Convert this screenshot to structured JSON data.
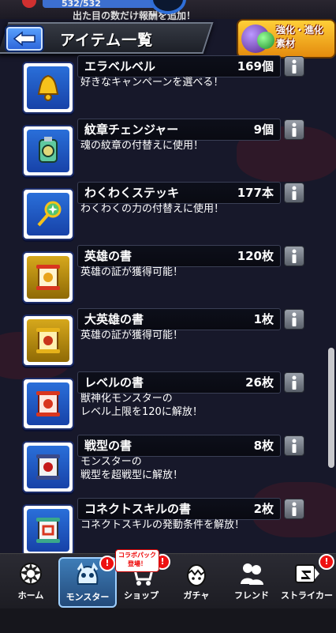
{
  "status": {
    "hp_text": "532/532",
    "top_note": "出た目の数だけ報酬を追加！"
  },
  "header": {
    "title": "アイテム一覧",
    "evolution_badge": "強化・進化素材"
  },
  "items": [
    {
      "name": "エラベルベル",
      "qty": "169個",
      "desc": "好きなキャンペーンを選べる！",
      "icon": "bell-icon"
    },
    {
      "name": "紋章チェンジャー",
      "qty": "9個",
      "desc": "魂の紋章の付替えに使用！",
      "icon": "emblem-changer-icon"
    },
    {
      "name": "わくわくステッキ",
      "qty": "177本",
      "desc": "わくわくの力の付替えに使用！",
      "icon": "wand-icon"
    },
    {
      "name": "英雄の書",
      "qty": "120枚",
      "desc": "英雄の証が獲得可能！",
      "icon": "scroll-icon"
    },
    {
      "name": "大英雄の書",
      "qty": "1枚",
      "desc": "英雄の証が獲得可能！",
      "icon": "scroll-icon"
    },
    {
      "name": "レベルの書",
      "qty": "26枚",
      "desc": "獣神化モンスターの\nレベル上限を120に解放！",
      "icon": "scroll-icon"
    },
    {
      "name": "戦型の書",
      "qty": "8枚",
      "desc": "モンスターの\n戦型を超戦型に解放！",
      "icon": "scroll-icon"
    },
    {
      "name": "コネクトスキルの書",
      "qty": "2枚",
      "desc": "コネクトスキルの発動条件を解放！",
      "icon": "scroll-icon"
    }
  ],
  "nav": [
    {
      "label": "ホーム",
      "icon": "home-icon",
      "alert": false
    },
    {
      "label": "モンスター",
      "icon": "monster-icon",
      "alert": true
    },
    {
      "label": "ショップ",
      "icon": "shop-cart-icon",
      "alert": true,
      "promo": "コラボパック\n登場！"
    },
    {
      "label": "ガチャ",
      "icon": "gacha-egg-icon",
      "alert": false
    },
    {
      "label": "フレンド",
      "icon": "friends-icon",
      "alert": false
    },
    {
      "label": "ストライカー",
      "icon": "striker-icon",
      "alert": true
    }
  ],
  "alert_mark": "!"
}
